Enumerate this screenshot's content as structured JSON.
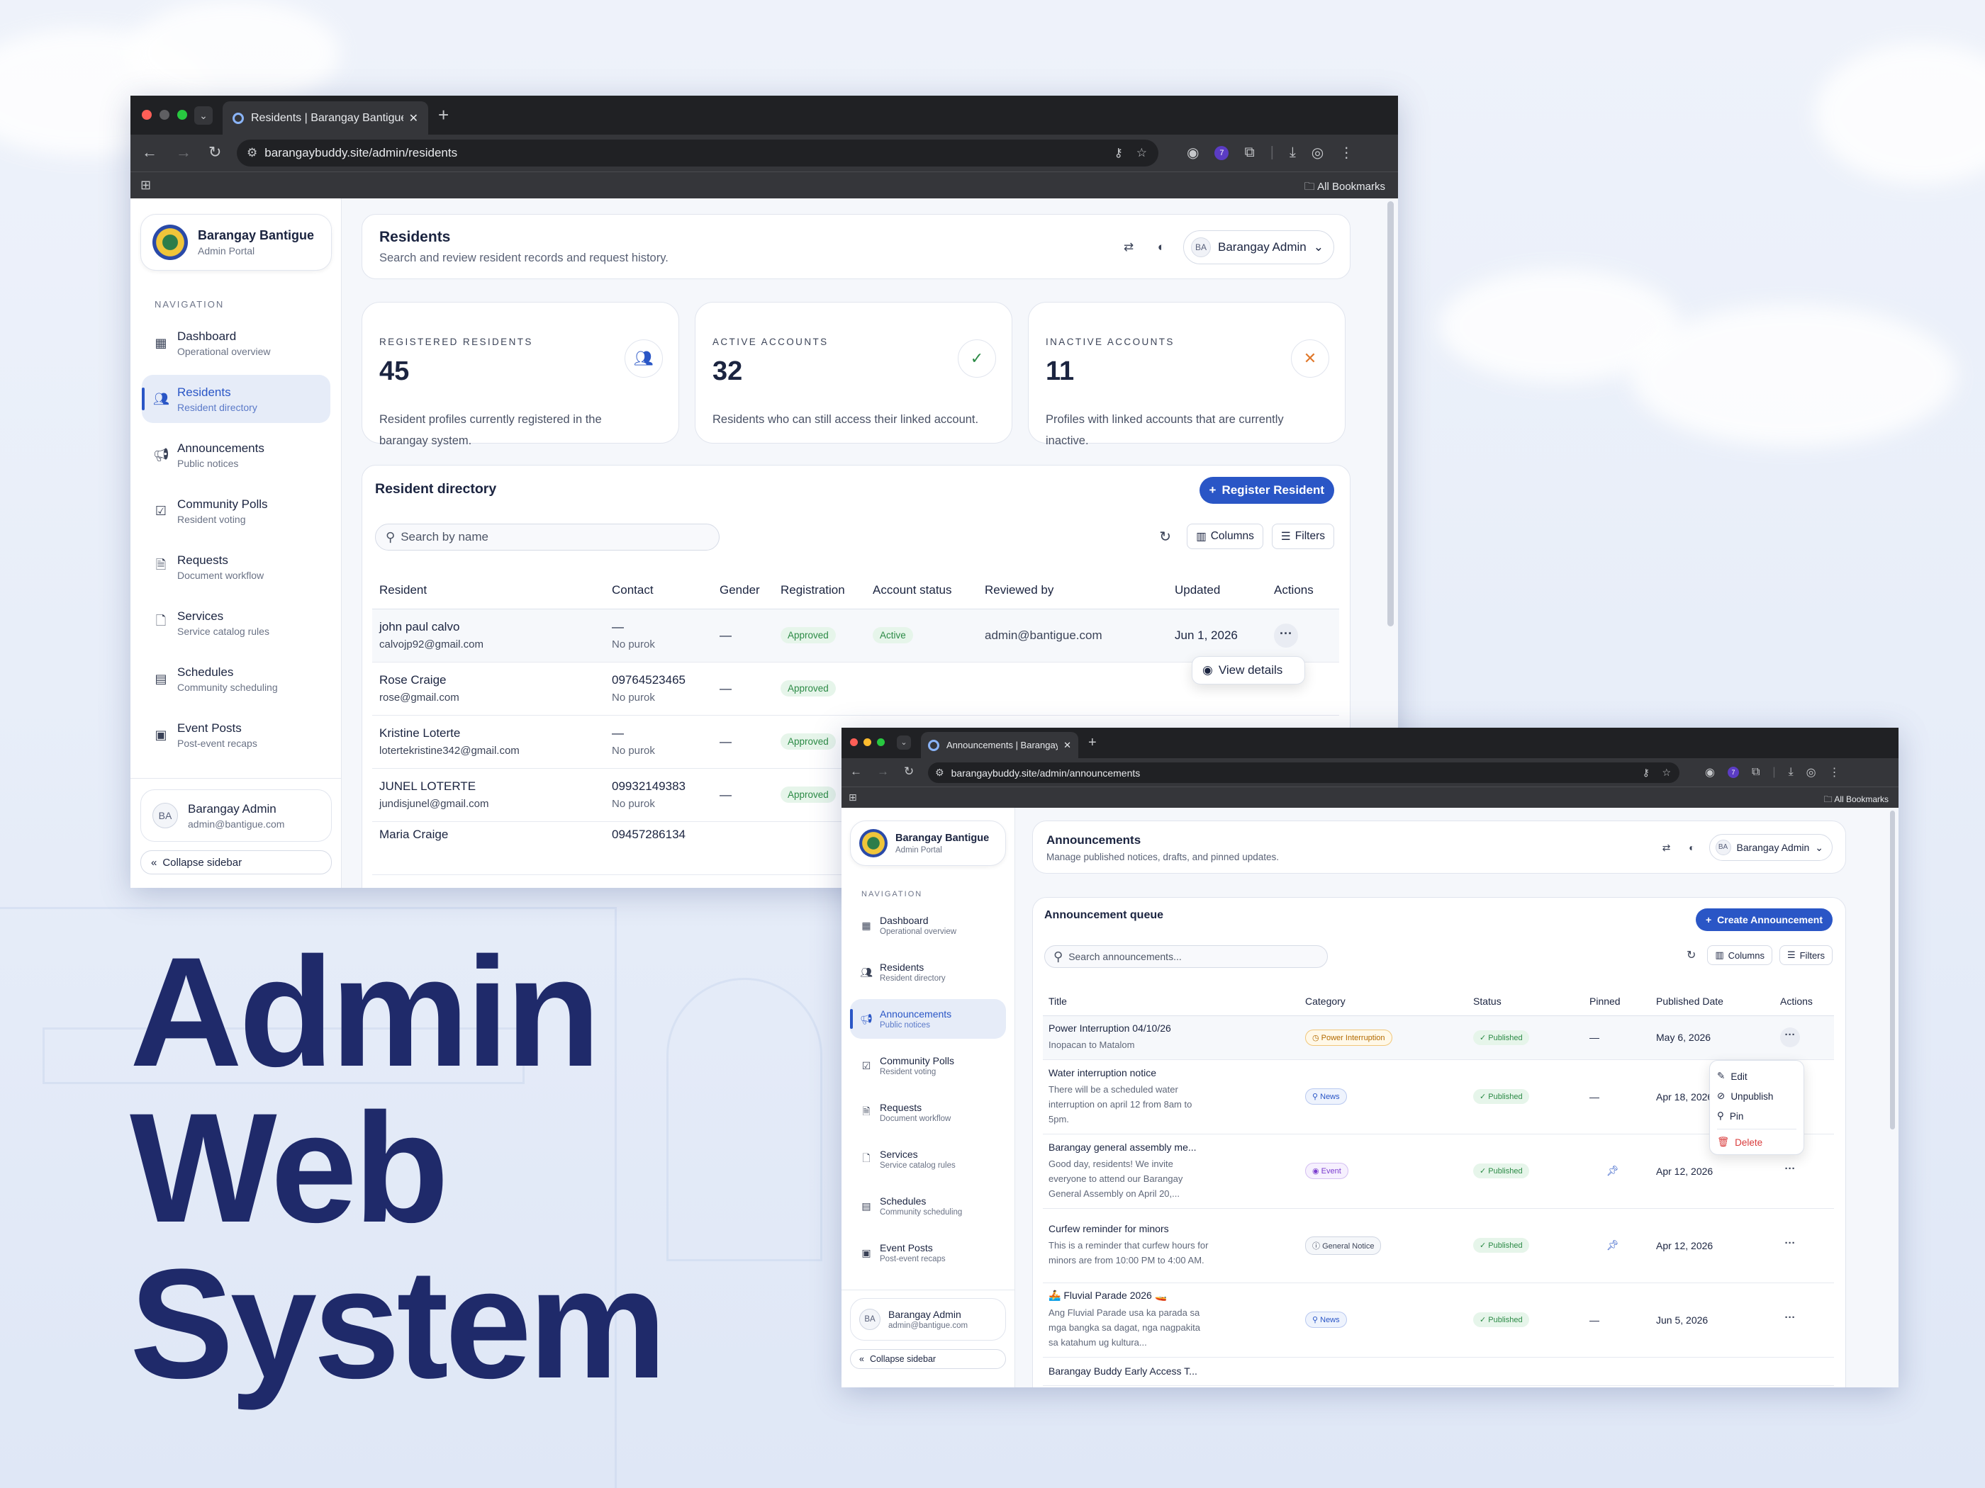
{
  "hero": {
    "line1": "Admin",
    "line2": "Web",
    "line3": "System"
  },
  "colors": {
    "accent": "#2a56c6",
    "hero": "#1f2a6a",
    "success": "#2b8a45"
  },
  "w1": {
    "tab_title": "Residents | Barangay Bantigue",
    "url": "barangaybuddy.site/admin/residents",
    "all_bookmarks": "All Bookmarks",
    "brand": {
      "name": "Barangay Bantigue",
      "sub": "Admin Portal"
    },
    "nav_label": "NAVIGATION",
    "nav": [
      {
        "label": "Dashboard",
        "sub": "Operational overview"
      },
      {
        "label": "Residents",
        "sub": "Resident directory"
      },
      {
        "label": "Announcements",
        "sub": "Public notices"
      },
      {
        "label": "Community Polls",
        "sub": "Resident voting"
      },
      {
        "label": "Requests",
        "sub": "Document workflow"
      },
      {
        "label": "Services",
        "sub": "Service catalog rules"
      },
      {
        "label": "Schedules",
        "sub": "Community scheduling"
      },
      {
        "label": "Event Posts",
        "sub": "Post-event recaps"
      }
    ],
    "user": {
      "initials": "BA",
      "name": "Barangay Admin",
      "email": "admin@bantigue.com"
    },
    "collapse": "Collapse sidebar",
    "header": {
      "title": "Residents",
      "subtitle": "Search and review resident records and request history.",
      "user": "Barangay Admin"
    },
    "stats": [
      {
        "label": "REGISTERED RESIDENTS",
        "value": "45",
        "desc": "Resident profiles currently registered in the barangay system."
      },
      {
        "label": "ACTIVE ACCOUNTS",
        "value": "32",
        "desc": "Residents who can still access their linked account."
      },
      {
        "label": "INACTIVE ACCOUNTS",
        "value": "11",
        "desc": "Profiles with linked accounts that are currently inactive."
      }
    ],
    "dir": {
      "title": "Resident directory",
      "register": "Register Resident",
      "search_placeholder": "Search by name",
      "columns": "Columns",
      "filters": "Filters",
      "headers": [
        "Resident",
        "Contact",
        "Gender",
        "Registration",
        "Account status",
        "Reviewed by",
        "Updated",
        "Actions"
      ],
      "rows": [
        {
          "name": "john paul calvo",
          "email": "calvojp92@gmail.com",
          "contact": "—",
          "purok": "No purok",
          "gender": "—",
          "reg": "Approved",
          "status": "Active",
          "reviewer": "admin@bantigue.com",
          "updated": "Jun 1, 2026"
        },
        {
          "name": "Rose Craige",
          "email": "rose@gmail.com",
          "contact": "09764523465",
          "purok": "No purok",
          "gender": "—",
          "reg": "Approved"
        },
        {
          "name": "Kristine Loterte",
          "email": "lotertekristine342@gmail.com",
          "contact": "—",
          "purok": "No purok",
          "gender": "—",
          "reg": "Approved"
        },
        {
          "name": "JUNEL LOTERTE",
          "email": "jundisjunel@gmail.com",
          "contact": "09932149383",
          "purok": "No purok",
          "gender": "—",
          "reg": "Approved"
        },
        {
          "name": "Maria Craige",
          "contact": "09457286134"
        }
      ],
      "view_details": "View details"
    }
  },
  "w2": {
    "tab_title": "Announcements | Barangay Bantigue",
    "url": "barangaybuddy.site/admin/announcements",
    "all_bookmarks": "All Bookmarks",
    "header": {
      "title": "Announcements",
      "subtitle": "Manage published notices, drafts, and pinned updates.",
      "user": "Barangay Admin"
    },
    "queue": {
      "title": "Announcement queue",
      "create": "Create Announcement",
      "search_placeholder": "Search announcements...",
      "columns": "Columns",
      "filters": "Filters",
      "headers": [
        "Title",
        "Category",
        "Status",
        "Pinned",
        "Published Date",
        "Actions"
      ],
      "rows": [
        {
          "title": "Power Interruption 04/10/26",
          "body": "Inopacan to Matalom",
          "category": "Power Interruption",
          "status": "Published",
          "pinned": "—",
          "date": "May 6, 2026"
        },
        {
          "title": "Water interruption notice",
          "body": "There will be a scheduled water interruption on april 12 from 8am to 5pm.",
          "category": "News",
          "status": "Published",
          "pinned": "—",
          "date": "Apr 18, 2026"
        },
        {
          "title": "Barangay general assembly me...",
          "body": "Good day, residents! We invite everyone to attend our Barangay General Assembly on April 20,...",
          "category": "Event",
          "status": "Published",
          "pinned": "pin",
          "date": "Apr 12, 2026"
        },
        {
          "title": "Curfew reminder for minors",
          "body": "This is a reminder that curfew hours for minors are from 10:00 PM to 4:00 AM.",
          "category": "General Notice",
          "status": "Published",
          "pinned": "pin",
          "date": "Apr 12, 2026"
        },
        {
          "title": "🚣 Fluvial Parade 2026 🚤",
          "body": "Ang Fluvial Parade usa ka parada sa mga bangka sa dagat, nga nagpakita sa katahum ug kultura...",
          "category": "News",
          "status": "Published",
          "pinned": "—",
          "date": "Jun 5, 2026"
        },
        {
          "title": "Barangay Buddy Early Access T..."
        }
      ],
      "menu": {
        "edit": "Edit",
        "unpublish": "Unpublish",
        "pin": "Pin",
        "delete": "Delete"
      }
    }
  }
}
